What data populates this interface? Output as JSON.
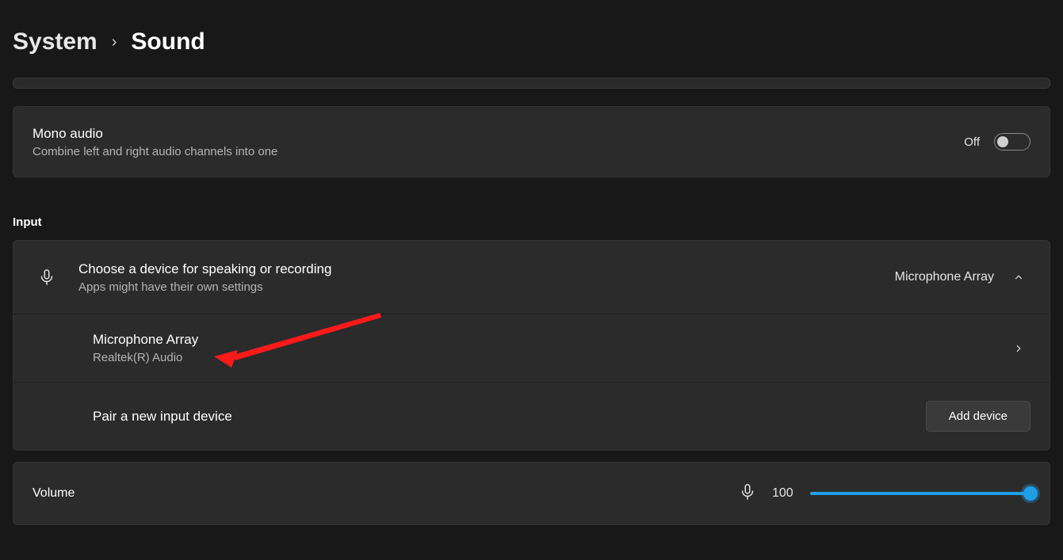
{
  "breadcrumb": {
    "parent": "System",
    "current": "Sound"
  },
  "mono": {
    "title": "Mono audio",
    "sub": "Combine left and right audio channels into one",
    "state_label": "Off"
  },
  "input": {
    "section": "Input",
    "choose_title": "Choose a device for speaking or recording",
    "choose_sub": "Apps might have their own settings",
    "selected": "Microphone Array",
    "device": {
      "name": "Microphone Array",
      "driver": "Realtek(R) Audio"
    },
    "pair_label": "Pair a new input device",
    "add_btn": "Add device"
  },
  "volume": {
    "label": "Volume",
    "value": "100"
  }
}
